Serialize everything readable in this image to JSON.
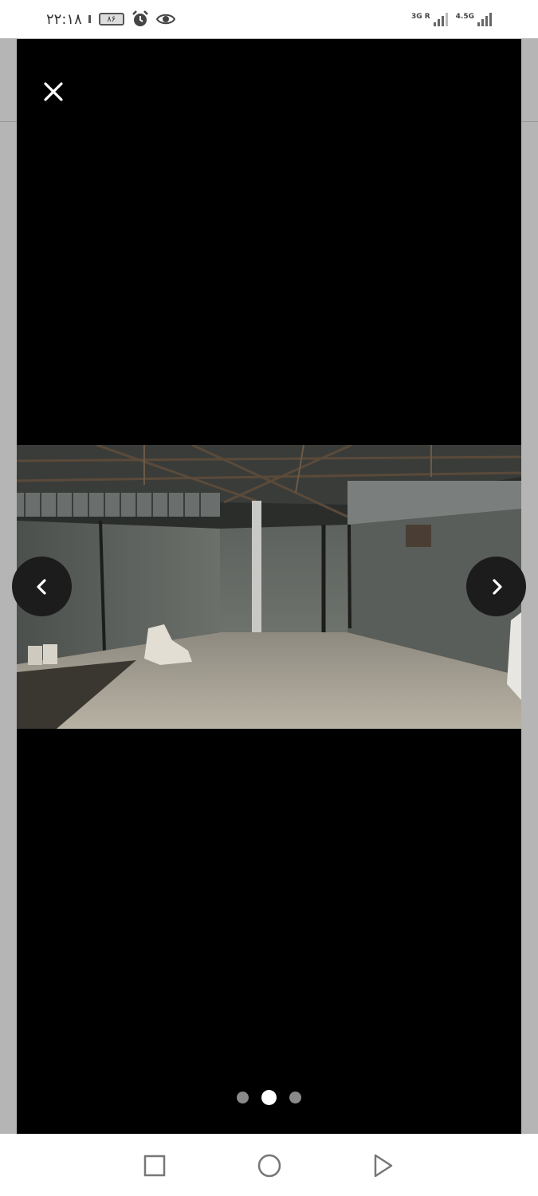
{
  "status_bar": {
    "time": "۲۲:۱۸",
    "battery": "۸۶",
    "network_1": "3G R",
    "network_2": "4.5G",
    "icons": [
      "battery-icon",
      "alarm-icon",
      "eye-icon",
      "signal-icon"
    ]
  },
  "viewer": {
    "close_icon": "close-icon",
    "prev_icon": "chevron-left-icon",
    "next_icon": "chevron-right-icon",
    "image_subject": "warehouse-photo",
    "slides_total": 3,
    "active_slide": 2
  },
  "system_nav": {
    "icons": [
      "recents-icon",
      "home-icon",
      "back-icon"
    ]
  },
  "colors": {
    "viewer_bg": "#000000",
    "page_bg": "#b5b5b5",
    "bar_bg": "#ffffff",
    "dot_active": "#ffffff",
    "dot_inactive": "#8a8a8a"
  }
}
